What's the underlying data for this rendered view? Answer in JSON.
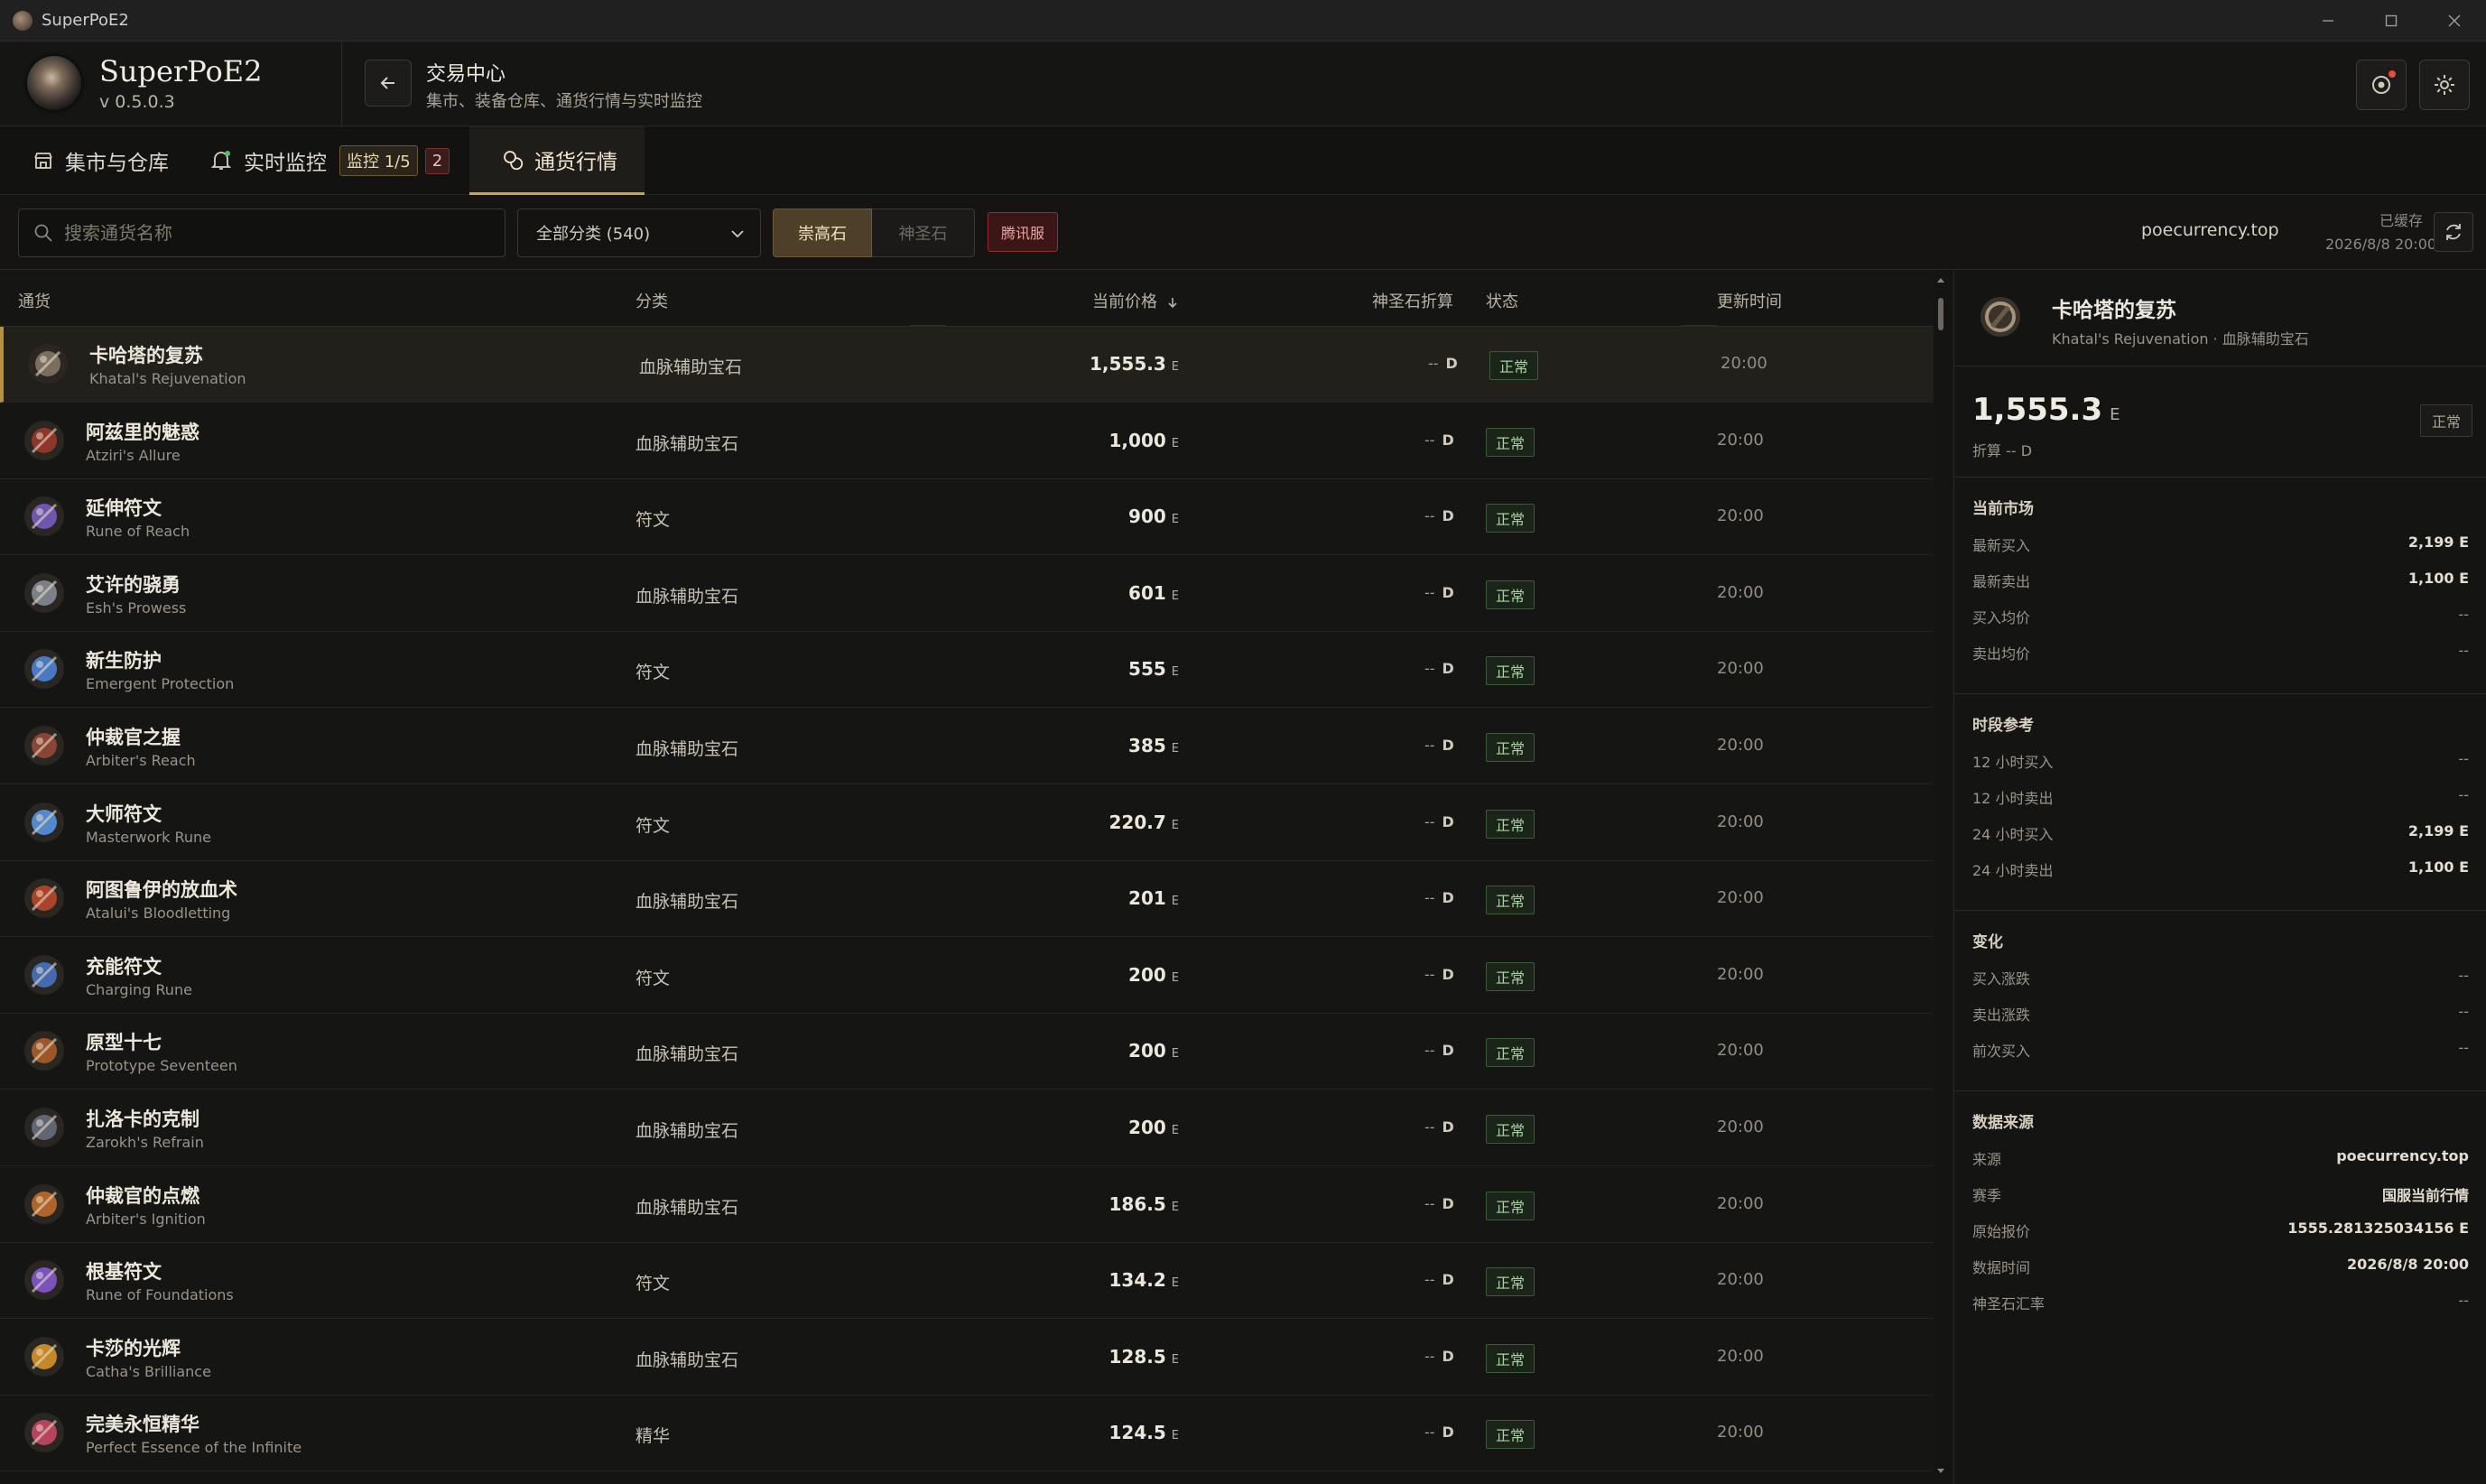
{
  "app": {
    "window_title": "SuperPoE2",
    "name": "SuperPoE2",
    "version": "v 0.5.0.3"
  },
  "header": {
    "title": "交易中心",
    "subtitle": "集市、装备仓库、通货行情与实时监控"
  },
  "tabs": [
    {
      "label": "集市与仓库",
      "icon": "store-icon"
    },
    {
      "label": "实时监控",
      "icon": "bell-icon",
      "badge": "监控 1/5",
      "count": "2"
    },
    {
      "label": "通货行情",
      "icon": "coins-icon",
      "active": true
    }
  ],
  "filters": {
    "search_placeholder": "搜索通货名称",
    "category_select": "全部分类 (540)",
    "currency_on": "崇高石",
    "currency_off": "神圣石",
    "server": "腾讯服",
    "source_site": "poecurrency.top",
    "cached_label": "已缓存",
    "cached_time": "2026/8/8 20:00"
  },
  "table": {
    "headers": {
      "currency": "通货",
      "category": "分类",
      "price": "当前价格",
      "divine": "神圣石折算",
      "status": "状态",
      "updated": "更新时间"
    },
    "sort_icon": "arrow-down-icon",
    "rows": [
      {
        "name": "卡哈塔的复苏",
        "en": "Khatal's Rejuvenation",
        "category": "血脉辅助宝石",
        "price": "1,555.3",
        "unit": "E",
        "divine": "--",
        "divine_unit": "D",
        "status": "正常",
        "time": "20:00",
        "selected": true,
        "color": "#8a7b66"
      },
      {
        "name": "阿兹里的魅惑",
        "en": "Atziri's Allure",
        "category": "血脉辅助宝石",
        "price": "1,000",
        "unit": "E",
        "divine": "--",
        "divine_unit": "D",
        "status": "正常",
        "time": "20:00",
        "color": "#a03a2a"
      },
      {
        "name": "延伸符文",
        "en": "Rune of Reach",
        "category": "符文",
        "price": "900",
        "unit": "E",
        "divine": "--",
        "divine_unit": "D",
        "status": "正常",
        "time": "20:00",
        "color": "#7b5fc8"
      },
      {
        "name": "艾许的骁勇",
        "en": "Esh's Prowess",
        "category": "血脉辅助宝石",
        "price": "601",
        "unit": "E",
        "divine": "--",
        "divine_unit": "D",
        "status": "正常",
        "time": "20:00",
        "color": "#8a8f9a"
      },
      {
        "name": "新生防护",
        "en": "Emergent Protection",
        "category": "符文",
        "price": "555",
        "unit": "E",
        "divine": "--",
        "divine_unit": "D",
        "status": "正常",
        "time": "20:00",
        "color": "#4e8ae0"
      },
      {
        "name": "仲裁官之握",
        "en": "Arbiter's Reach",
        "category": "血脉辅助宝石",
        "price": "385",
        "unit": "E",
        "divine": "--",
        "divine_unit": "D",
        "status": "正常",
        "time": "20:00",
        "color": "#9a4a3a"
      },
      {
        "name": "大师符文",
        "en": "Masterwork Rune",
        "category": "符文",
        "price": "220.7",
        "unit": "E",
        "divine": "--",
        "divine_unit": "D",
        "status": "正常",
        "time": "20:00",
        "color": "#5a9be8"
      },
      {
        "name": "阿图鲁伊的放血术",
        "en": "Atalui's Bloodletting",
        "category": "血脉辅助宝石",
        "price": "201",
        "unit": "E",
        "divine": "--",
        "divine_unit": "D",
        "status": "正常",
        "time": "20:00",
        "color": "#c04a2a"
      },
      {
        "name": "充能符文",
        "en": "Charging Rune",
        "category": "符文",
        "price": "200",
        "unit": "E",
        "divine": "--",
        "divine_unit": "D",
        "status": "正常",
        "time": "20:00",
        "color": "#4a78c8"
      },
      {
        "name": "原型十七",
        "en": "Prototype Seventeen",
        "category": "血脉辅助宝石",
        "price": "200",
        "unit": "E",
        "divine": "--",
        "divine_unit": "D",
        "status": "正常",
        "time": "20:00",
        "color": "#b0602a"
      },
      {
        "name": "扎洛卡的克制",
        "en": "Zarokh's Refrain",
        "category": "血脉辅助宝石",
        "price": "200",
        "unit": "E",
        "divine": "--",
        "divine_unit": "D",
        "status": "正常",
        "time": "20:00",
        "color": "#6a7280"
      },
      {
        "name": "仲裁官的点燃",
        "en": "Arbiter's Ignition",
        "category": "血脉辅助宝石",
        "price": "186.5",
        "unit": "E",
        "divine": "--",
        "divine_unit": "D",
        "status": "正常",
        "time": "20:00",
        "color": "#c8702a"
      },
      {
        "name": "根基符文",
        "en": "Rune of Foundations",
        "category": "符文",
        "price": "134.2",
        "unit": "E",
        "divine": "--",
        "divine_unit": "D",
        "status": "正常",
        "time": "20:00",
        "color": "#8a5ad8"
      },
      {
        "name": "卡莎的光辉",
        "en": "Catha's Brilliance",
        "category": "血脉辅助宝石",
        "price": "128.5",
        "unit": "E",
        "divine": "--",
        "divine_unit": "D",
        "status": "正常",
        "time": "20:00",
        "color": "#e09a2a"
      },
      {
        "name": "完美永恒精华",
        "en": "Perfect Essence of the Infinite",
        "category": "精华",
        "price": "124.5",
        "unit": "E",
        "divine": "--",
        "divine_unit": "D",
        "status": "正常",
        "time": "20:00",
        "color": "#d04a6a"
      }
    ]
  },
  "detail": {
    "name": "卡哈塔的复苏",
    "subtitle": "Khatal's Rejuvenation · 血脉辅助宝石",
    "price": "1,555.3",
    "unit": "E",
    "divine_label": "折算 -- D",
    "status": "正常",
    "sections": [
      {
        "title": "当前市场",
        "rows": [
          {
            "k": "最新买入",
            "v": "2,199 E"
          },
          {
            "k": "最新卖出",
            "v": "1,100 E"
          },
          {
            "k": "买入均价",
            "v": "--"
          },
          {
            "k": "卖出均价",
            "v": "--"
          }
        ]
      },
      {
        "title": "时段参考",
        "rows": [
          {
            "k": "12 小时买入",
            "v": "--"
          },
          {
            "k": "12 小时卖出",
            "v": "--"
          },
          {
            "k": "24 小时买入",
            "v": "2,199 E"
          },
          {
            "k": "24 小时卖出",
            "v": "1,100 E"
          }
        ]
      },
      {
        "title": "变化",
        "rows": [
          {
            "k": "买入涨跌",
            "v": "--"
          },
          {
            "k": "卖出涨跌",
            "v": "--"
          },
          {
            "k": "前次买入",
            "v": "--"
          }
        ]
      },
      {
        "title": "数据来源",
        "rows": [
          {
            "k": "来源",
            "v": "poecurrency.top"
          },
          {
            "k": "赛季",
            "v": "国服当前行情"
          },
          {
            "k": "原始报价",
            "v": "1555.281325034156 E"
          },
          {
            "k": "数据时间",
            "v": "2026/8/8 20:00"
          },
          {
            "k": "神圣石汇率",
            "v": "--"
          }
        ]
      }
    ]
  }
}
